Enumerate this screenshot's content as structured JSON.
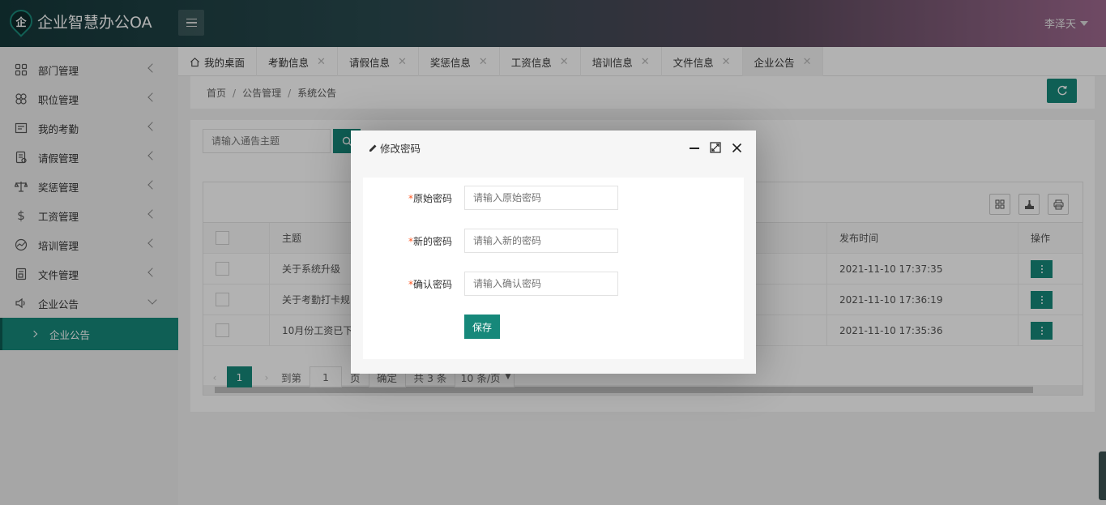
{
  "header": {
    "logo_char": "企",
    "app_title": "企业智慧办公OA",
    "user_name": "李泽天"
  },
  "sidebar": {
    "items": [
      {
        "label": "部门管理",
        "icon": "grid-icon"
      },
      {
        "label": "职位管理",
        "icon": "clover-icon"
      },
      {
        "label": "我的考勤",
        "icon": "calendar-icon"
      },
      {
        "label": "请假管理",
        "icon": "form-icon"
      },
      {
        "label": "奖惩管理",
        "icon": "scale-icon"
      },
      {
        "label": "工资管理",
        "icon": "dollar-icon"
      },
      {
        "label": "培训管理",
        "icon": "chart-icon"
      },
      {
        "label": "文件管理",
        "icon": "file-icon"
      },
      {
        "label": "企业公告",
        "icon": "speaker-icon"
      }
    ],
    "sub_item": "企业公告"
  },
  "tabs": [
    {
      "label": "我的桌面",
      "closable": false
    },
    {
      "label": "考勤信息",
      "closable": true
    },
    {
      "label": "请假信息",
      "closable": true
    },
    {
      "label": "奖惩信息",
      "closable": true
    },
    {
      "label": "工资信息",
      "closable": true
    },
    {
      "label": "培训信息",
      "closable": true
    },
    {
      "label": "文件信息",
      "closable": true
    },
    {
      "label": "企业公告",
      "closable": true,
      "active": true
    }
  ],
  "breadcrumb": [
    "首页",
    "公告管理",
    "系统公告"
  ],
  "search": {
    "placeholder": "请输入通告主题"
  },
  "table": {
    "headers": {
      "title": "主题",
      "time": "发布时间",
      "op": "操作"
    },
    "rows": [
      {
        "title": "关于系统升级",
        "time": "2021-11-10 17:37:35"
      },
      {
        "title": "关于考勤打卡规",
        "time": "2021-11-10 17:36:19"
      },
      {
        "title": "10月份工资已下",
        "time": "2021-11-10 17:35:36"
      }
    ]
  },
  "pager": {
    "current": "1",
    "goto_label": "到第",
    "goto_value": "1",
    "page_unit": "页",
    "confirm": "确定",
    "total": "共 3 条",
    "page_size": "10 条/页"
  },
  "modal": {
    "title": "修改密码",
    "fields": [
      {
        "label": "原始密码",
        "placeholder": "请输入原始密码"
      },
      {
        "label": "新的密码",
        "placeholder": "请输入新的密码"
      },
      {
        "label": "确认密码",
        "placeholder": "请输入确认密码"
      }
    ],
    "required_mark": "*",
    "save": "保存"
  },
  "colors": {
    "accent": "#16887a",
    "required": "#ff5722"
  }
}
